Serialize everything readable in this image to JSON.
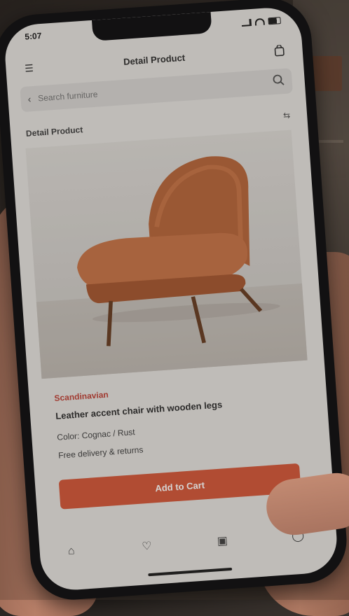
{
  "status_bar": {
    "time": "5:07"
  },
  "header": {
    "title": "Detail Product"
  },
  "search": {
    "placeholder": "Search furniture"
  },
  "section": {
    "label": "Detail Product"
  },
  "product": {
    "category": "Scandinavian",
    "title": "Leather accent chair with wooden legs",
    "line1": "Color: Cognac / Rust",
    "line2": "Free delivery & returns",
    "cta_label": "Add to Cart"
  },
  "colors": {
    "accent": "#d45a3c",
    "category": "#c0453a",
    "leather": "#b8683e"
  },
  "icons": {
    "header_left": "menu-icon",
    "header_right": "cart-icon",
    "search": "search-icon",
    "filter": "filter-icon",
    "tabs": [
      "home-icon",
      "heart-icon",
      "bag-icon",
      "profile-icon"
    ]
  }
}
